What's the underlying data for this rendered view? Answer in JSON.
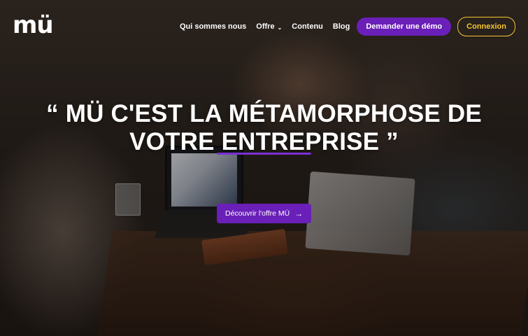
{
  "brand": {
    "logo_text": "mü"
  },
  "nav": {
    "items": [
      {
        "label": "Qui sommes nous"
      },
      {
        "label": "Offre",
        "has_dropdown": true
      },
      {
        "label": "Contenu"
      },
      {
        "label": "Blog"
      }
    ],
    "demo_button": "Demander une démo",
    "login_button": "Connexion"
  },
  "hero": {
    "headline_line1": "“ MÜ C'EST LA MÉTAMORPHOSE DE",
    "headline_line2": "VOTRE ENTREPRISE ”",
    "cta_label": "Découvrir l'offre MÜ",
    "cta_icon": "arrow-right-icon"
  },
  "colors": {
    "accent_purple": "#6a1fb8",
    "login_yellow": "#f5c531",
    "text_white": "#ffffff"
  }
}
